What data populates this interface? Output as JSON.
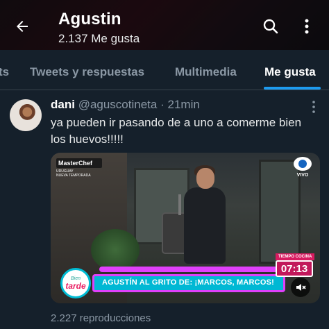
{
  "header": {
    "name": "Agustin",
    "subtitle": "2.137 Me gusta",
    "back_icon": "arrow-left-icon",
    "search_icon": "search-icon",
    "more_icon": "more-vertical-icon"
  },
  "tabs": [
    {
      "label": "ts",
      "active": false
    },
    {
      "label": "Tweets y respuestas",
      "active": false
    },
    {
      "label": "Multimedia",
      "active": false
    },
    {
      "label": "Me gusta",
      "active": true
    }
  ],
  "tweet": {
    "author_name": "dani",
    "author_handle": "@aguscotineta",
    "separator": "·",
    "time": "21min",
    "text": "ya pueden ir pasando de a uno a comerme bien los huevos!!!!!",
    "media": {
      "logo": "MasterChef",
      "logo_sub": "URUGUAY",
      "logo_sub2": "NUEVA TEMPORADA",
      "channel": "VIVO",
      "timer_label": "TIEMPO COCINA",
      "timer": "07:13",
      "lower_third": "AGUSTÍN AL GRITO DE: ¡MARCOS, MARCOS!",
      "badge_top": "Bien",
      "badge_main": "tarde"
    },
    "views": "2.227 reproducciones"
  },
  "colors": {
    "background": "#15202b",
    "accent": "#1d9bf0",
    "muted": "#8b98a5"
  }
}
